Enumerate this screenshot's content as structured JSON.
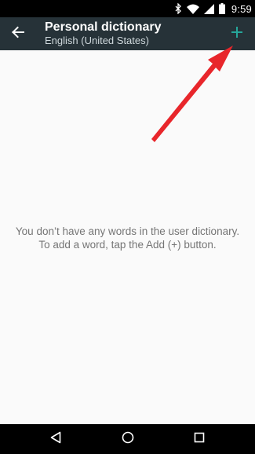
{
  "status_bar": {
    "time": "9:59",
    "icons": [
      "bluetooth-icon",
      "wifi-icon",
      "signal-icon",
      "battery-icon"
    ]
  },
  "app_bar": {
    "title": "Personal dictionary",
    "subtitle": "English (United States)",
    "back_icon": "arrow-back-icon",
    "add_icon": "plus-icon",
    "background_color": "#263238",
    "accent_color": "#26a69a"
  },
  "content": {
    "empty_line_1": "You don’t have any words in the user dictionary.",
    "empty_line_2": "To add a word, tap the Add (+) button."
  },
  "annotation": {
    "arrow_color": "#e8262b"
  },
  "nav_bar": {
    "icons": [
      "back-triangle-icon",
      "home-circle-icon",
      "recents-square-icon"
    ]
  }
}
